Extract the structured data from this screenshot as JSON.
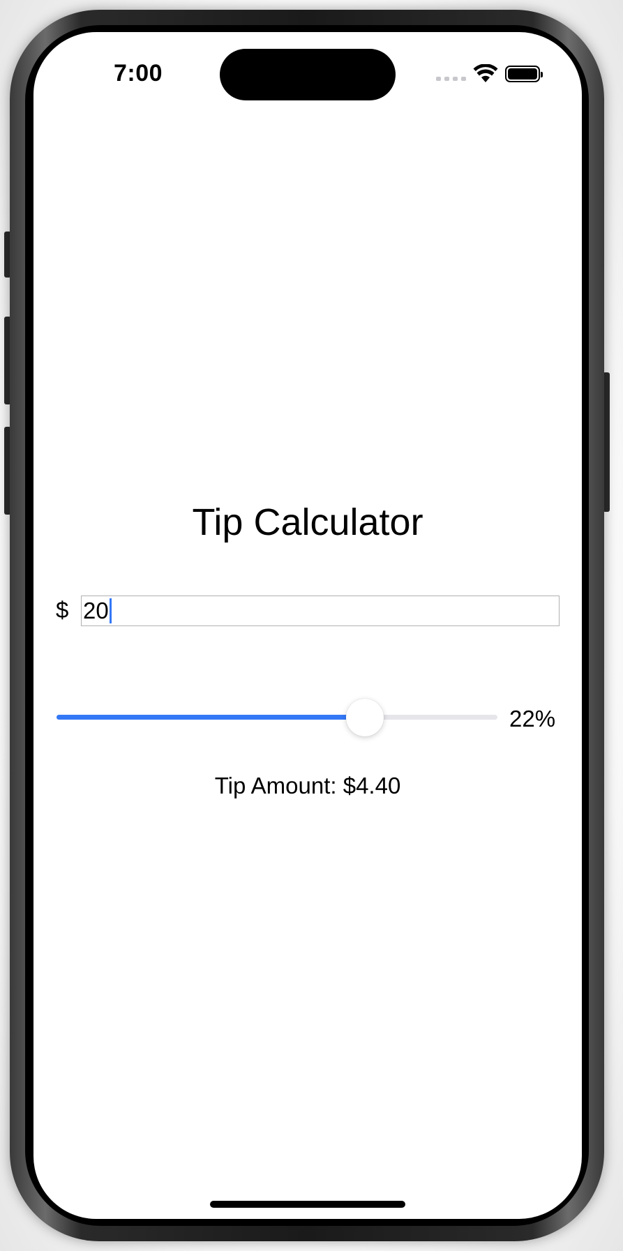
{
  "status_bar": {
    "time": "7:00",
    "icons": [
      "signal-icon",
      "wifi-icon",
      "battery-icon"
    ]
  },
  "app": {
    "title": "Tip Calculator",
    "currency_symbol": "$",
    "bill_amount": "20",
    "tip_percent_label": "22%",
    "tip_slider_fraction": 0.7,
    "tip_amount_label": "Tip Amount: $4.40"
  },
  "colors": {
    "accent": "#3478f6",
    "track": "#e5e5ea"
  }
}
